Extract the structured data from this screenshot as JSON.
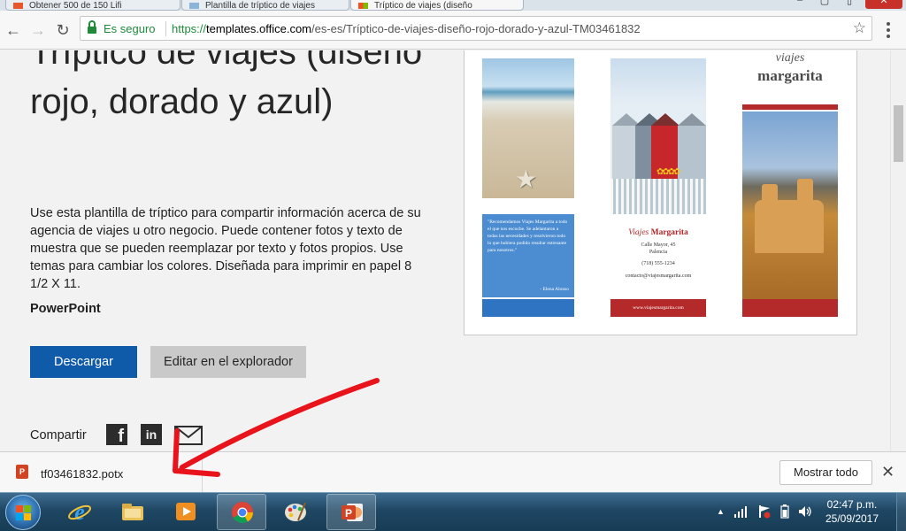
{
  "tabs": [
    {
      "title": "Obtener 500 de 150 Lifi"
    },
    {
      "title": "Plantilla de tríptico de viajes"
    },
    {
      "title": "Tríptico de viajes (diseño"
    }
  ],
  "address_bar": {
    "secure_label": "Es seguro",
    "url_scheme": "https://",
    "url_host": "templates.office.com",
    "url_path": "/es-es/Tríptico-de-viajes-diseño-rojo-dorado-y-azul-TM03461832"
  },
  "page": {
    "title": "Tríptico de viajes (diseño rojo, dorado y azul)",
    "description": "Use esta plantilla de tríptico para compartir información acerca de su agencia de viajes u otro negocio. Puede contener fotos y texto de muestra que se pueden reemplazar por texto y fotos propios. Use temas para cambiar los colores. Diseñada para imprimir en papel 8 1/2 X 11.",
    "application": "PowerPoint",
    "download_label": "Descargar",
    "edit_label": "Editar en el explorador",
    "share_label": "Compartir"
  },
  "preview": {
    "quote": "\"Recomendamos Viajes Margarita a todo el que nos escuche. Se adelantaron a todas las necesidades y resolvieron todo lo que hubiera podido resultar estresante para nosotros.\"",
    "quote_author": "- Elena Alonso",
    "brand_italic": "Viajes",
    "brand_bold": "Margarita",
    "address_line1": "Calle Mayor, 45",
    "address_line2": "Palencia",
    "phone": "(718) 555-1234",
    "email": "contacto@viajesmargarita.com",
    "website": "www.viajesmargarita.com",
    "cover_line1": "viajes",
    "cover_line2": "margarita"
  },
  "download_shelf": {
    "file_name": "tf03461832.potx",
    "show_all_label": "Mostrar todo"
  },
  "taskbar": {
    "time": "02:47 p.m.",
    "date": "25/09/2017",
    "pinned": [
      "internet-explorer",
      "file-explorer",
      "media-player",
      "chrome",
      "paint",
      "powerpoint"
    ]
  },
  "colors": {
    "download_button": "#0f5ba9",
    "secure_green": "#1e8a3a",
    "annotation_red": "#e8131b",
    "brand_red": "#b42929"
  }
}
